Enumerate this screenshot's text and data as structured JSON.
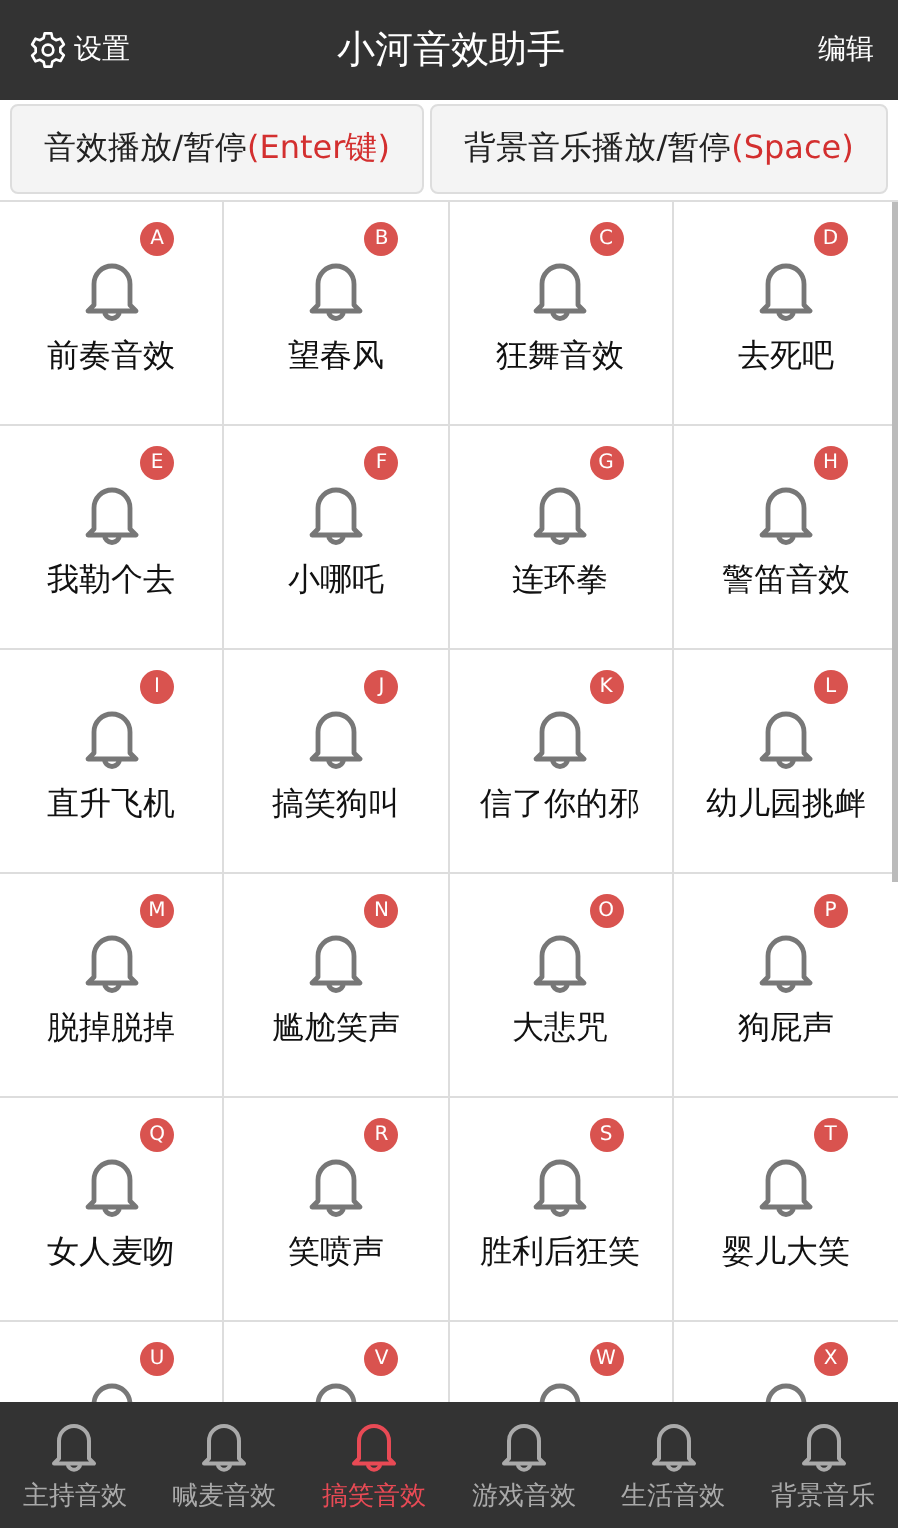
{
  "header": {
    "settings": "设置",
    "title": "小河音效助手",
    "edit": "编辑"
  },
  "controls": [
    {
      "label": "音效播放/暂停",
      "hotkey": "(Enter键)"
    },
    {
      "label": "背景音乐播放/暂停",
      "hotkey": "(Space)"
    }
  ],
  "sounds": [
    {
      "badge": "A",
      "name": "前奏音效"
    },
    {
      "badge": "B",
      "name": "望春风"
    },
    {
      "badge": "C",
      "name": "狂舞音效"
    },
    {
      "badge": "D",
      "name": "去死吧"
    },
    {
      "badge": "E",
      "name": "我勒个去"
    },
    {
      "badge": "F",
      "name": "小哪吒"
    },
    {
      "badge": "G",
      "name": "连环拳"
    },
    {
      "badge": "H",
      "name": "警笛音效"
    },
    {
      "badge": "I",
      "name": "直升飞机"
    },
    {
      "badge": "J",
      "name": "搞笑狗叫"
    },
    {
      "badge": "K",
      "name": "信了你的邪"
    },
    {
      "badge": "L",
      "name": "幼儿园挑衅"
    },
    {
      "badge": "M",
      "name": "脱掉脱掉"
    },
    {
      "badge": "N",
      "name": "尴尬笑声"
    },
    {
      "badge": "O",
      "name": "大悲咒"
    },
    {
      "badge": "P",
      "name": "狗屁声"
    },
    {
      "badge": "Q",
      "name": "女人麦吻"
    },
    {
      "badge": "R",
      "name": "笑喷声"
    },
    {
      "badge": "S",
      "name": "胜利后狂笑"
    },
    {
      "badge": "T",
      "name": "婴儿大笑"
    },
    {
      "badge": "U"
    },
    {
      "badge": "V"
    },
    {
      "badge": "W"
    },
    {
      "badge": "X"
    }
  ],
  "tabs": [
    {
      "label": "主持音效",
      "selected": false
    },
    {
      "label": "喊麦音效",
      "selected": false
    },
    {
      "label": "搞笑音效",
      "selected": true
    },
    {
      "label": "游戏音效",
      "selected": false
    },
    {
      "label": "生活音效",
      "selected": false
    },
    {
      "label": "背景音乐",
      "selected": false
    }
  ]
}
